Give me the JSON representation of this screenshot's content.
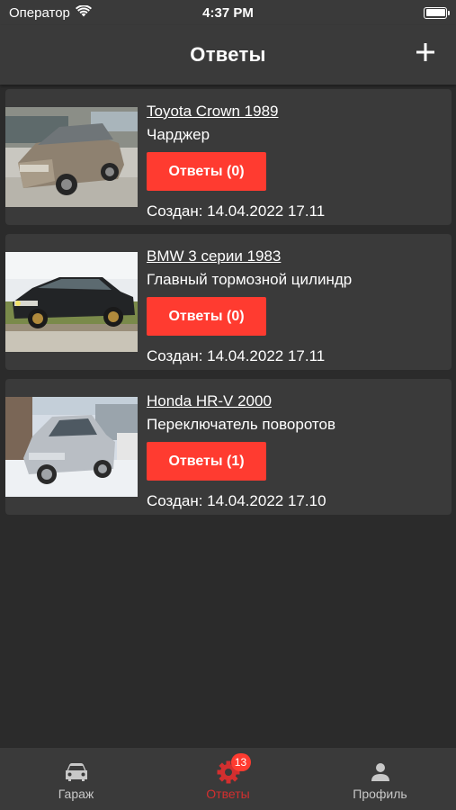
{
  "status_bar": {
    "carrier": "Оператор",
    "time": "4:37 PM"
  },
  "nav": {
    "title": "Ответы",
    "add_icon": "plus-icon"
  },
  "requests": [
    {
      "car": "Toyota Crown 1989",
      "part": "Чарджер",
      "answers_label": "Ответы (0)",
      "created": "Создан: 14.04.2022 17.11"
    },
    {
      "car": "BMW 3 серии 1983",
      "part": "Главный тормозной цилиндр",
      "answers_label": "Ответы (0)",
      "created": "Создан: 14.04.2022 17.11"
    },
    {
      "car": "Honda HR-V 2000",
      "part": "Переключатель поворотов",
      "answers_label": "Ответы (1)",
      "created": "Создан: 14.04.2022 17.10"
    }
  ],
  "tabs": [
    {
      "label": "Гараж",
      "icon": "car-icon"
    },
    {
      "label": "Ответы",
      "icon": "gear-icon",
      "badge": "13"
    },
    {
      "label": "Профиль",
      "icon": "person-icon"
    }
  ],
  "colors": {
    "background": "#2b2b2b",
    "card": "#3a3a3a",
    "accent": "#ff3b30",
    "active_tab": "#d32f2f"
  }
}
